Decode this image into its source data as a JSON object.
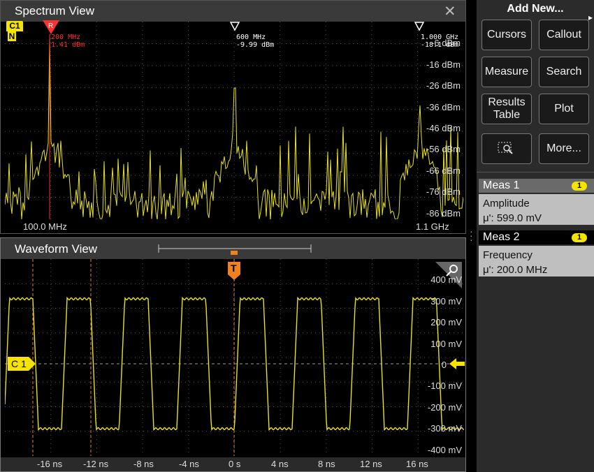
{
  "spectrum": {
    "title": "Spectrum View",
    "close_icon": "close-icon",
    "channel_badge": "C1",
    "channel_sub": "N",
    "ref_marker": "R",
    "markers": [
      {
        "freq": "200 MHz",
        "level": "1.41 dBm",
        "color": "#ff3030"
      },
      {
        "freq": "600 MHz",
        "level": "-9.99 dBm",
        "color": "#ffffff"
      },
      {
        "freq": "1.000 GHz",
        "level": "-18.1 dBm",
        "color": "#ffffff"
      }
    ],
    "y_labels": [
      "-6 dBm",
      "-16 dBm",
      "-26 dBm",
      "-36 dBm",
      "-46 dBm",
      "-56 dBm",
      "-66 dBm",
      "-76 dBm",
      "-86 dBm"
    ],
    "x_start": "100.0 MHz",
    "x_end": "1.1 GHz",
    "trace_color": "#e8e020"
  },
  "waveform": {
    "title": "Waveform View",
    "trigger_label": "T",
    "channel_label": "C 1",
    "y_labels": [
      "400 mV",
      "300 mV",
      "200 mV",
      "100 mV",
      "0",
      "-100 mV",
      "-200 mV",
      "-300 mV",
      "-400 mV"
    ],
    "x_labels": [
      "-16 ns",
      "-12 ns",
      "-8 ns",
      "-4 ns",
      "0 s",
      "4 ns",
      "8 ns",
      "12 ns",
      "16 ns"
    ],
    "trace_color": "#e8e020",
    "zoom_icon": "zoom-icon"
  },
  "sidebar": {
    "add_new": "Add New...",
    "buttons": [
      "Cursors",
      "Callout",
      "Measure",
      "Search",
      "Results Table",
      "Plot",
      "",
      "More..."
    ],
    "meas": [
      {
        "name": "Meas 1",
        "badge": "1",
        "label": "Amplitude",
        "value": "μ': 599.0 mV"
      },
      {
        "name": "Meas 2",
        "badge": "1",
        "label": "Frequency",
        "value": "μ': 200.0 MHz"
      }
    ],
    "colors": {
      "badge": "#f5e400",
      "meas_active": "#000000"
    }
  }
}
